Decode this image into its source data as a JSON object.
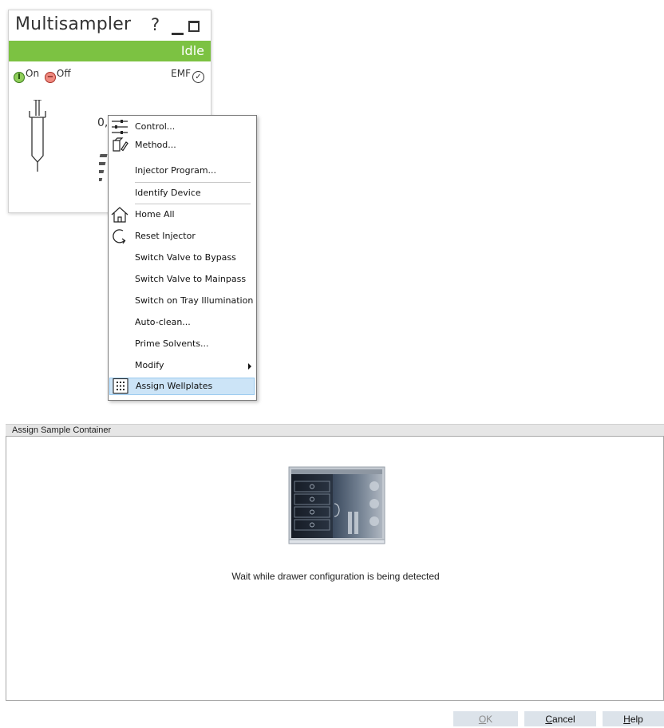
{
  "module": {
    "title": "Multisampler",
    "help": "?",
    "status": "Idle",
    "on_label": "On",
    "off_label": "Off",
    "emf_label": "EMF",
    "value": "0,",
    "status_color": "#7cc242"
  },
  "menu": {
    "items": [
      {
        "label": "Control...",
        "icon": "sliders-icon"
      },
      {
        "label": "Method...",
        "icon": "method-edit-icon"
      },
      {
        "label": "Injector Program...",
        "icon": ""
      },
      {
        "label": "Identify Device",
        "icon": ""
      },
      {
        "label": "Home All",
        "icon": "home-icon"
      },
      {
        "label": "Reset Injector",
        "icon": "reset-icon"
      },
      {
        "label": "Switch Valve to Bypass",
        "icon": ""
      },
      {
        "label": "Switch Valve to Mainpass",
        "icon": ""
      },
      {
        "label": "Switch on Tray Illumination",
        "icon": ""
      },
      {
        "label": "Auto-clean...",
        "icon": ""
      },
      {
        "label": "Prime Solvents...",
        "icon": ""
      },
      {
        "label": "Modify",
        "icon": "",
        "submenu": true
      },
      {
        "label": "Assign Wellplates",
        "icon": "wellplate-grid-icon",
        "highlighted": true
      }
    ]
  },
  "dialog": {
    "title": "Assign Sample Container",
    "message": "Wait while drawer configuration is being detected",
    "buttons": {
      "ok": {
        "mnemonic": "O",
        "rest": "K",
        "enabled": false
      },
      "cancel": {
        "mnemonic": "C",
        "rest": "ancel",
        "enabled": true
      },
      "help": {
        "mnemonic": "H",
        "rest": "elp",
        "enabled": true
      }
    }
  }
}
